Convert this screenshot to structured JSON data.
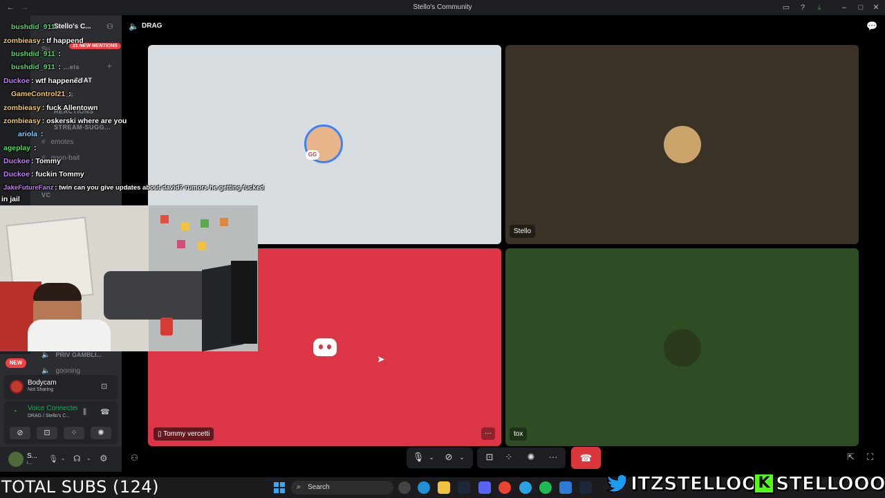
{
  "window": {
    "title": "Stello's Community"
  },
  "server": {
    "name": "Stello's C...",
    "new_mentions": "21 NEW MENTIONS",
    "new_badge": "NEW"
  },
  "channels": {
    "visible_tail": [
      "Su...",
      "...els",
      "...CHAT",
      "...s",
      "REACTIONS",
      "STREAM-SUGG...",
      "emotes",
      "goon-bait",
      "VC"
    ],
    "bottom": [
      "PRIV GAMBLI...",
      "gooning"
    ]
  },
  "voice_channel": {
    "name": "DRAG"
  },
  "bodycam": {
    "name": "Bodycam",
    "status": "Not Sharing"
  },
  "voice_status": {
    "label": "Voice Connected",
    "location": "DRAG / Stello's C..."
  },
  "user_panel": {
    "name": "S...",
    "status": "i..."
  },
  "tiles": [
    {
      "id": "top-left",
      "name": "",
      "bg": "#d7dce1"
    },
    {
      "id": "top-right",
      "name": "Stello",
      "bg": "#3a3227"
    },
    {
      "id": "bottom-left",
      "name": "Tommy vercetti",
      "bg": "#dc3545"
    },
    {
      "id": "bottom-right",
      "name": "tox",
      "bg": "#2f4d25"
    }
  ],
  "chat": [
    {
      "user": "bushdid_911",
      "msg": "",
      "color": "#4cd964"
    },
    {
      "user": "zombieasy",
      "msg": "tf happend",
      "color": "#f4c96a"
    },
    {
      "user": "bushdid_911",
      "msg": "",
      "color": "#4cd964"
    },
    {
      "user": "bushdid_911",
      "msg": "",
      "color": "#4cd964"
    },
    {
      "user": "Duckoe",
      "msg": "wtf happened",
      "color": "#c77dff"
    },
    {
      "user": "GameControl21",
      "msg": "",
      "color": "#f4c96a"
    },
    {
      "user": "zombieasy",
      "msg": "fuck Allentown",
      "color": "#f4c96a"
    },
    {
      "user": "zombieasy",
      "msg": "oskerski where are you",
      "color": "#f4c96a"
    },
    {
      "user": "ariola",
      "msg": "",
      "color": "#7fd1ff"
    },
    {
      "user": "ageplay",
      "msg": "",
      "color": "#4cd964"
    },
    {
      "user": "Duckoe",
      "msg": "Tommy",
      "color": "#c77dff"
    },
    {
      "user": "Duckoe",
      "msg": "fuckin Tommy",
      "color": "#c77dff"
    },
    {
      "user": "JakeFutureFanz",
      "msg": "twin can you give updates about david? rumors he getting fucked",
      "color": "#c77dff"
    },
    {
      "user": "",
      "msg": "in jail",
      "color": "#ffffff"
    }
  ],
  "taskbar": {
    "search_placeholder": "Search"
  },
  "overlay": {
    "subs": "TOTAL SUBS (124)",
    "twitter_handle": "ITZSTELLOO",
    "kick_handle": "STELLOOO"
  },
  "colors": {
    "hangup": "#da373c",
    "discord_blurple": "#5865f2",
    "kick_green": "#53fc18",
    "twitter_blue": "#1d9bf0"
  }
}
